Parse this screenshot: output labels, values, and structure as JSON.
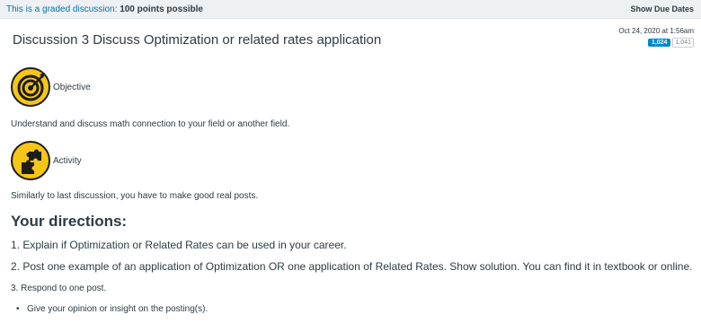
{
  "banner": {
    "graded_label": "This is a graded discussion:",
    "points_text": "100 points possible",
    "show_due_dates": "Show Due Dates"
  },
  "discussion": {
    "title": "Discussion 3 Discuss Optimization or related rates application",
    "timestamp": "Oct 24, 2020 at 1:56am",
    "count_primary": "1,024",
    "count_secondary": "1,041"
  },
  "sections": {
    "objective": {
      "icon": "target-icon",
      "label": "Objective",
      "text": "Understand and discuss math connection to your field or another field."
    },
    "activity": {
      "icon": "puzzle-icon",
      "label": "Activity",
      "text": "Similarly to last discussion, you have to make good real posts."
    }
  },
  "directions": {
    "heading": "Your directions:",
    "item1": "1. Explain if Optimization or Related Rates can be used in your career.",
    "item2": "2. Post one example of an application of Optimization OR one application of Related Rates. Show solution. You can find it in textbook or online.",
    "item3": "3. Respond to one post.",
    "bullet": "Give your opinion or insight on the posting(s)."
  },
  "colors": {
    "accent": "#0770a3",
    "badge_blue": "#0088cc",
    "icon_yellow": "#f5c518"
  }
}
